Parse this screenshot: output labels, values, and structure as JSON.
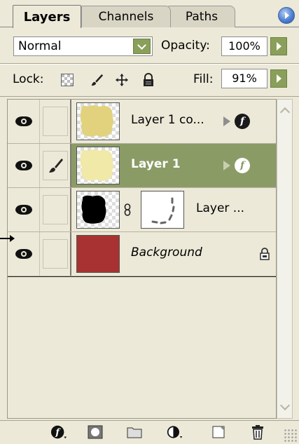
{
  "tabs": [
    {
      "label": "Layers",
      "active": true
    },
    {
      "label": "Channels",
      "active": false
    },
    {
      "label": "Paths",
      "active": false
    }
  ],
  "blend": {
    "mode": "Normal",
    "opacity_label": "Opacity:",
    "opacity_value": "100%"
  },
  "lock": {
    "label": "Lock:",
    "fill_label": "Fill:",
    "fill_value": "91%",
    "icons": [
      "lock-transparent-icon",
      "lock-image-brush-icon",
      "lock-position-move-icon",
      "lock-all-padlock-icon"
    ]
  },
  "layers": [
    {
      "name": "Layer 1 co...",
      "visible": true,
      "linked": false,
      "has_effects": true,
      "selected": false,
      "thumb_color": "#e2d27e"
    },
    {
      "name": "Layer 1",
      "visible": true,
      "linked": true,
      "has_effects": true,
      "selected": true,
      "thumb_color": "#f0e9a8"
    },
    {
      "name": "Layer ...",
      "visible": true,
      "linked": false,
      "has_mask": true,
      "selected": false,
      "thumb_color": "#000000"
    },
    {
      "name": "Background",
      "visible": true,
      "linked": false,
      "locked": true,
      "selected": false,
      "italic": true,
      "thumb_color": "#a83232"
    }
  ],
  "bottom_bar": {
    "buttons": [
      "add-layer-style-icon",
      "add-mask-icon",
      "new-group-folder-icon",
      "new-adjustment-layer-icon",
      "new-layer-icon",
      "delete-layer-trash-icon"
    ]
  },
  "colors": {
    "panel_bg": "#ece9d8",
    "selected_row": "#8b9b66",
    "stepper_green": "#8aa05a",
    "menu_blue": "#4f7fd0"
  }
}
